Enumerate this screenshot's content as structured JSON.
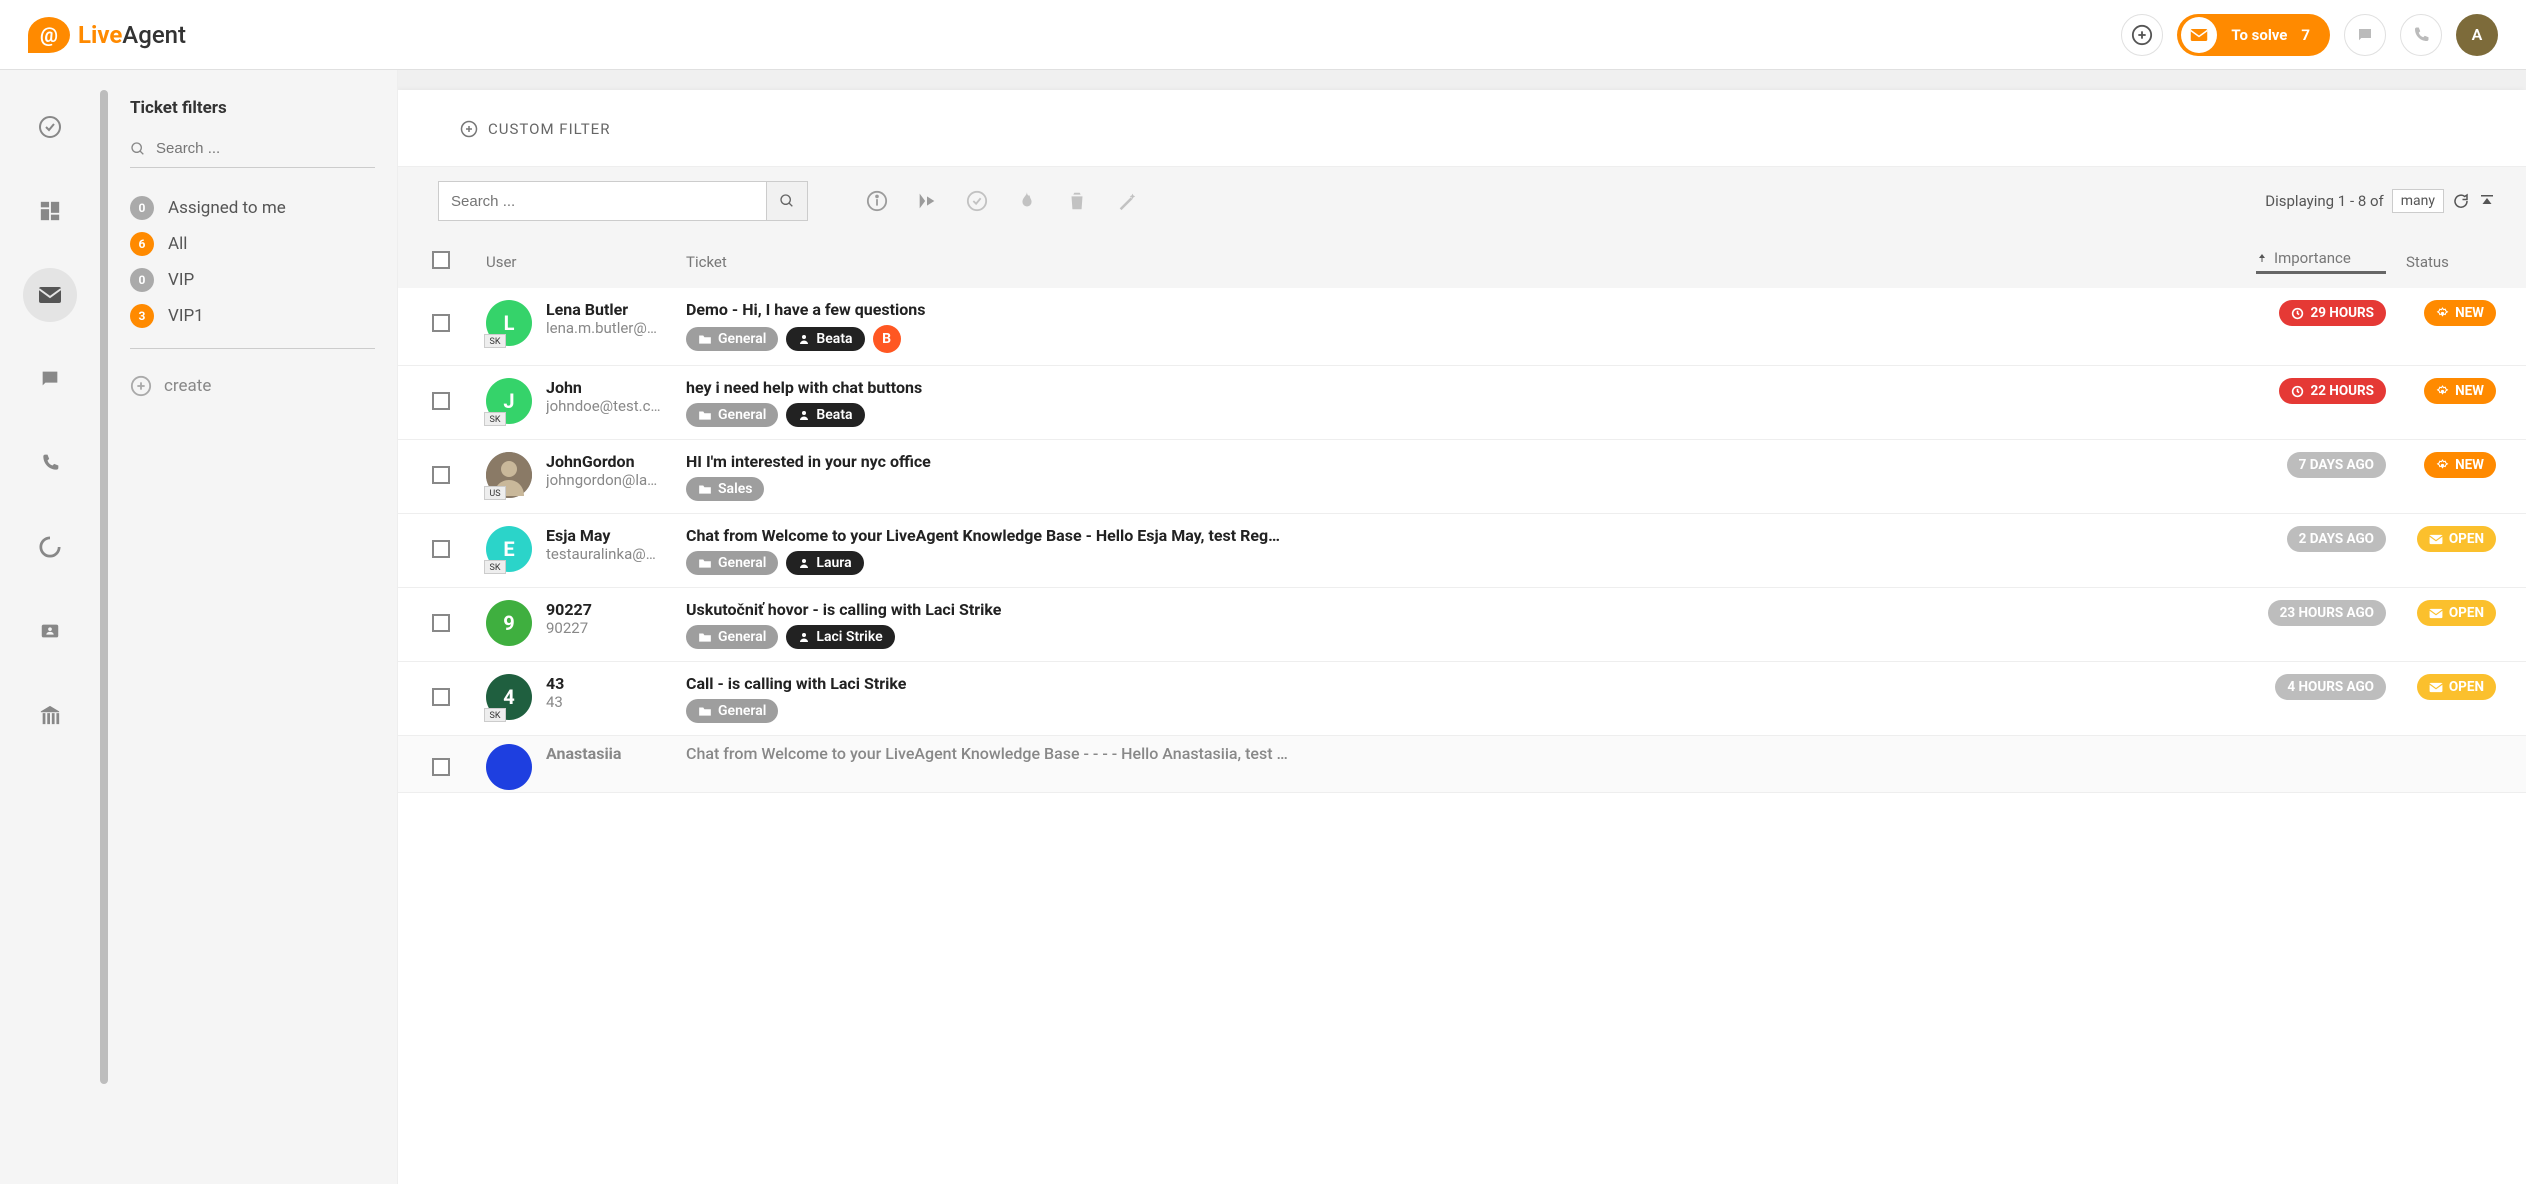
{
  "brand": {
    "live": "Live",
    "agent": "Agent",
    "badge_char": "@"
  },
  "header": {
    "tosolve_label": "To solve",
    "tosolve_count": "7",
    "avatar_letter": "A"
  },
  "filters": {
    "title": "Ticket filters",
    "search_placeholder": "Search ...",
    "items": [
      {
        "count": "0",
        "label": "Assigned to me",
        "color": "grey"
      },
      {
        "count": "6",
        "label": "All",
        "color": "orange"
      },
      {
        "count": "0",
        "label": "VIP",
        "color": "grey"
      },
      {
        "count": "3",
        "label": "VIP1",
        "color": "orange"
      }
    ],
    "create_label": "create"
  },
  "custom_filter_label": "CUSTOM FILTER",
  "toolbar": {
    "search_placeholder": "Search ...",
    "displaying_prefix": "Displaying 1 - 8 of",
    "many_label": "many"
  },
  "columns": {
    "user": "User",
    "ticket": "Ticket",
    "importance": "Importance",
    "status": "Status"
  },
  "tickets": [
    {
      "avatar_letter": "L",
      "avatar_color": "#35D36A",
      "flag": "SK",
      "user_name": "Lena Butler",
      "user_email": "lena.m.butler@…",
      "subject": "Demo - Hi, I have a few questions",
      "department": "General",
      "agent": "Beata",
      "extra_badge": "B",
      "importance_text": "29 HOURS",
      "importance_style": "red",
      "status_text": "NEW",
      "status_style": "orange",
      "status_icon": "gear"
    },
    {
      "avatar_letter": "J",
      "avatar_color": "#35D36A",
      "flag": "SK",
      "user_name": "John",
      "user_email": "johndoe@test.c…",
      "subject": "hey i need help with chat buttons",
      "department": "General",
      "agent": "Beata",
      "extra_badge": "",
      "importance_text": "22 HOURS",
      "importance_style": "red",
      "status_text": "NEW",
      "status_style": "orange",
      "status_icon": "gear"
    },
    {
      "avatar_letter": "",
      "avatar_color": "#777",
      "avatar_image": true,
      "flag": "US",
      "user_name": "JohnGordon",
      "user_email": "johngordon@la…",
      "subject": "HI I'm interested in your nyc office",
      "department": "Sales",
      "agent": "",
      "extra_badge": "",
      "importance_text": "7 DAYS AGO",
      "importance_style": "grey",
      "status_text": "NEW",
      "status_style": "orange",
      "status_icon": "gear"
    },
    {
      "avatar_letter": "E",
      "avatar_color": "#2BD4C9",
      "flag": "SK",
      "user_name": "Esja May",
      "user_email": "testauralinka@…",
      "subject": "Chat from Welcome to your LiveAgent Knowledge Base - Hello Esja May, test Reg…",
      "department": "General",
      "agent": "Laura",
      "extra_badge": "",
      "importance_text": "2 DAYS AGO",
      "importance_style": "grey",
      "status_text": "OPEN",
      "status_style": "yellow",
      "status_icon": "mail"
    },
    {
      "avatar_letter": "9",
      "avatar_color": "#3FAF3F",
      "flag": "",
      "user_name": "90227",
      "user_email": "90227",
      "subject": "Uskutočniť hovor - is calling with Laci Strike",
      "department": "General",
      "agent": "Laci Strike",
      "extra_badge": "",
      "importance_text": "23 HOURS AGO",
      "importance_style": "grey",
      "status_text": "OPEN",
      "status_style": "yellow",
      "status_icon": "mail"
    },
    {
      "avatar_letter": "4",
      "avatar_color": "#1F5F3F",
      "flag": "SK",
      "user_name": "43",
      "user_email": "43",
      "subject": "Call - is calling with Laci Strike",
      "department": "General",
      "agent": "",
      "extra_badge": "",
      "importance_text": "4 HOURS AGO",
      "importance_style": "grey",
      "status_text": "OPEN",
      "status_style": "yellow",
      "status_icon": "mail"
    },
    {
      "avatar_letter": "",
      "avatar_color": "#1E3FE0",
      "flag": "",
      "user_name": "Anastasiia",
      "user_email": "",
      "subject": "Chat from Welcome to your LiveAgent Knowledge Base - - - - Hello Anastasiia, test …",
      "department": "",
      "agent": "",
      "extra_badge": "",
      "importance_text": "",
      "importance_style": "",
      "status_text": "",
      "status_style": "",
      "truncated": true
    }
  ]
}
